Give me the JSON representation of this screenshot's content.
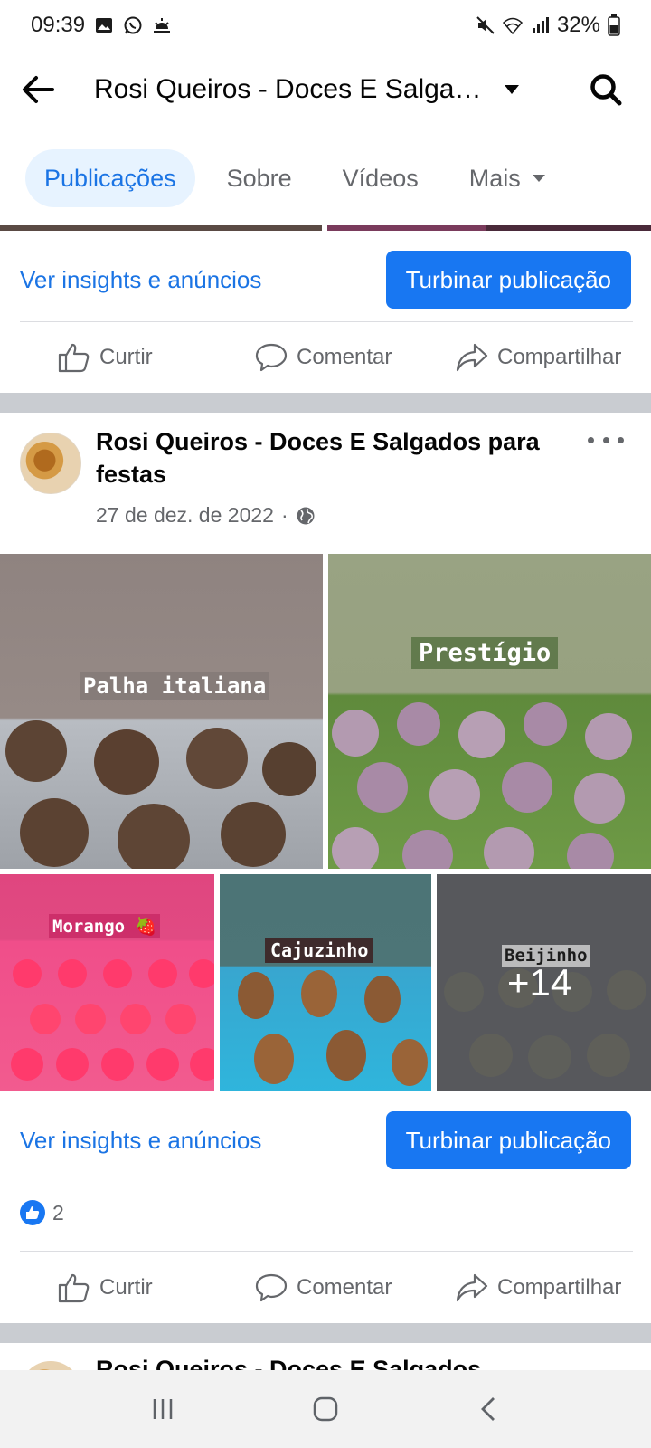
{
  "status_bar": {
    "time": "09:39",
    "battery": "32%"
  },
  "app_bar": {
    "title": "Rosi Queiros - Doces E Salgados para festas",
    "icons": [
      "back-arrow-icon",
      "chevron-down-icon",
      "search-icon"
    ]
  },
  "tabs": [
    {
      "label": "Publicações",
      "active": true
    },
    {
      "label": "Sobre",
      "active": false
    },
    {
      "label": "Vídeos",
      "active": false
    },
    {
      "label": "Mais",
      "active": false
    }
  ],
  "previous_post": {
    "insights_link": "Ver insights e anúncios",
    "boost_button": "Turbinar publicação",
    "actions": {
      "like": "Curtir",
      "comment": "Comentar",
      "share": "Compartilhar"
    }
  },
  "post": {
    "author": "Rosi Queiros - Doces E Salgados para festas",
    "date": "27 de dez. de 2022",
    "audience_icon": "globe-icon",
    "photos": [
      {
        "label": "Palha italiana"
      },
      {
        "label": "Prestígio"
      },
      {
        "label": "Morango 🍓"
      },
      {
        "label": "Cajuzinho"
      },
      {
        "label": "Beijinho",
        "more_count": "+14"
      }
    ],
    "insights_link": "Ver insights e anúncios",
    "boost_button": "Turbinar publicação",
    "reaction_count": "2",
    "actions": {
      "like": "Curtir",
      "comment": "Comentar",
      "share": "Compartilhar"
    }
  },
  "next_post": {
    "author": "Rosi Queiros - Doces E Salgados"
  },
  "colors": {
    "accent": "#1877f2",
    "link": "#1b74e4",
    "active_tab_bg": "#e7f3ff",
    "separator": "#c9ccd1"
  }
}
